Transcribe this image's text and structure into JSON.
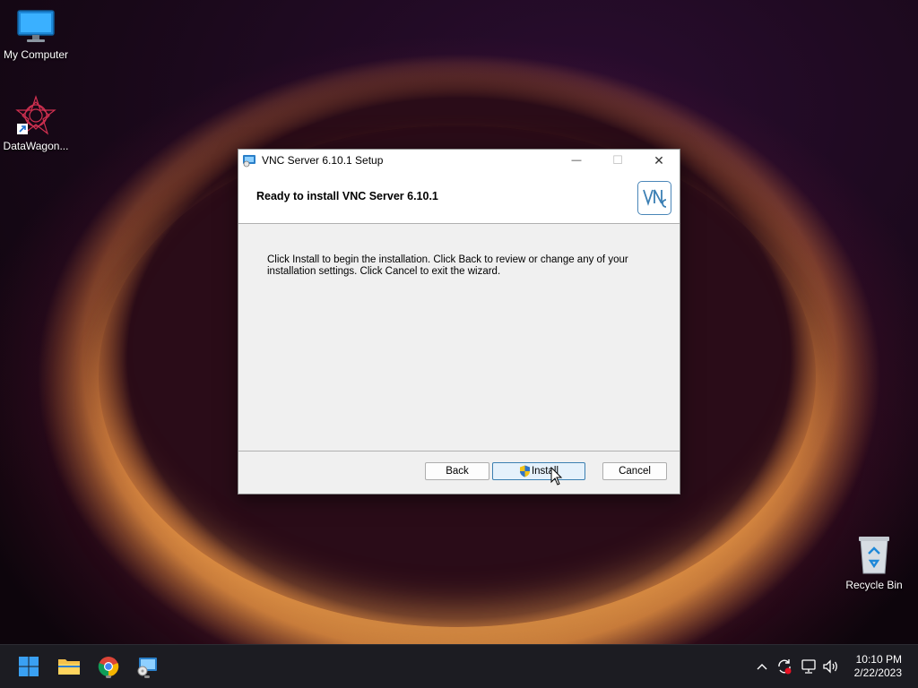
{
  "desktop": {
    "icons": [
      {
        "label": "My Computer",
        "icon": "monitor-icon"
      },
      {
        "label": "DataWagon...",
        "icon": "datawagon-icon"
      },
      {
        "label": "Recycle Bin",
        "icon": "recycle-bin-icon"
      }
    ]
  },
  "window": {
    "title": "VNC Server 6.10.1 Setup",
    "header_title": "Ready to install VNC Server 6.10.1",
    "body_text": "Click Install to begin the installation. Click Back to review or change any of your installation settings. Click Cancel to exit the wizard.",
    "buttons": {
      "back": "Back",
      "install": "Install",
      "cancel": "Cancel"
    },
    "controls": {
      "minimize": "—",
      "maximize": "☐",
      "close": "✕"
    },
    "logo_text": "VNC"
  },
  "taskbar": {
    "items": [
      "start-icon",
      "file-explorer-icon",
      "chrome-icon",
      "installer-icon"
    ],
    "tray": [
      "chevron-up-icon",
      "sync-icon",
      "network-icon",
      "volume-icon"
    ],
    "time": "10:10 PM",
    "date": "2/22/2023"
  },
  "colors": {
    "accent": "#3c7fb1",
    "taskbar": "#1c1c22"
  }
}
